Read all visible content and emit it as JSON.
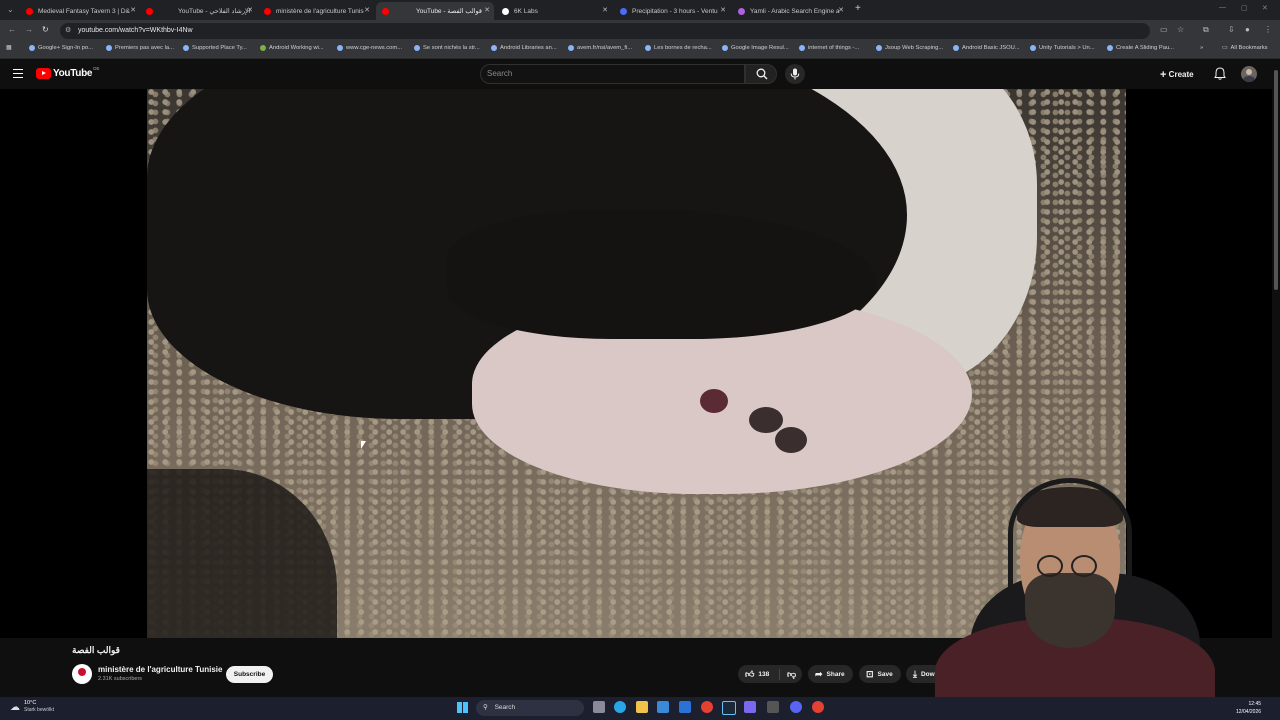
{
  "browser": {
    "tabs": [
      {
        "title": "Medieval Fantasy Tavern 3 | D&",
        "favicon_color": "#ff0000",
        "active": false
      },
      {
        "title": "YouTube - الإرشاد الفلاحي",
        "favicon_color": "#ff0000",
        "active": false
      },
      {
        "title": "ministère de l'agriculture Tunis",
        "favicon_color": "#ff0000",
        "active": false
      },
      {
        "title": "YouTube - قوالب الفصة",
        "favicon_color": "#ff0000",
        "active": true
      },
      {
        "title": "6K Labs",
        "favicon_color": "#ffffff",
        "active": false
      },
      {
        "title": "Precipitation - 3 hours - Ventu",
        "favicon_color": "#4a6cf7",
        "active": false
      },
      {
        "title": "Yamli - Arabic Search Engine a",
        "favicon_color": "#b060e0",
        "active": false
      }
    ],
    "url": "youtube.com/watch?v=WKthbv-I4Nw",
    "bookmarks": [
      "Google+ Sign-In po...",
      "Premiers pas avec la...",
      "Supported Place Ty...",
      "Android Working wi...",
      "www.cge-news.com...",
      "Se sont nichés la str...",
      "Android Libraries an...",
      "avem.fr/nsi/avem_fi...",
      "Les bornes de recha...",
      "Google Image Resul...",
      "internet of things -...",
      "Jsoup Web Scraping...",
      "Android Basic JSOU...",
      "Unity Tutorials > Un...",
      "Create A Sliding Pau..."
    ],
    "all_bookmarks": "All Bookmarks"
  },
  "youtube": {
    "logo_text": "YouTube",
    "country_code": "DE",
    "search_placeholder": "Search",
    "create_label": "Create",
    "video_title": "قوالب الفصة",
    "channel_name": "ministère de l'agriculture Tunisie",
    "subscribers": "2.31K subscribers",
    "subscribe_label": "Subscribe",
    "likes": "138",
    "share_label": "Share",
    "save_label": "Save",
    "download_label": "Down"
  },
  "taskbar": {
    "temperature": "10°C",
    "condition": "Stark bewölkt",
    "search_label": "Search",
    "time": "12:45",
    "date": "12/04/2026"
  },
  "colors": {
    "youtube_red": "#ff0000",
    "page_bg": "#0f0f0f",
    "tab_strip": "#202124",
    "toolbar": "#35363a",
    "taskbar": "#1b1f2e"
  }
}
